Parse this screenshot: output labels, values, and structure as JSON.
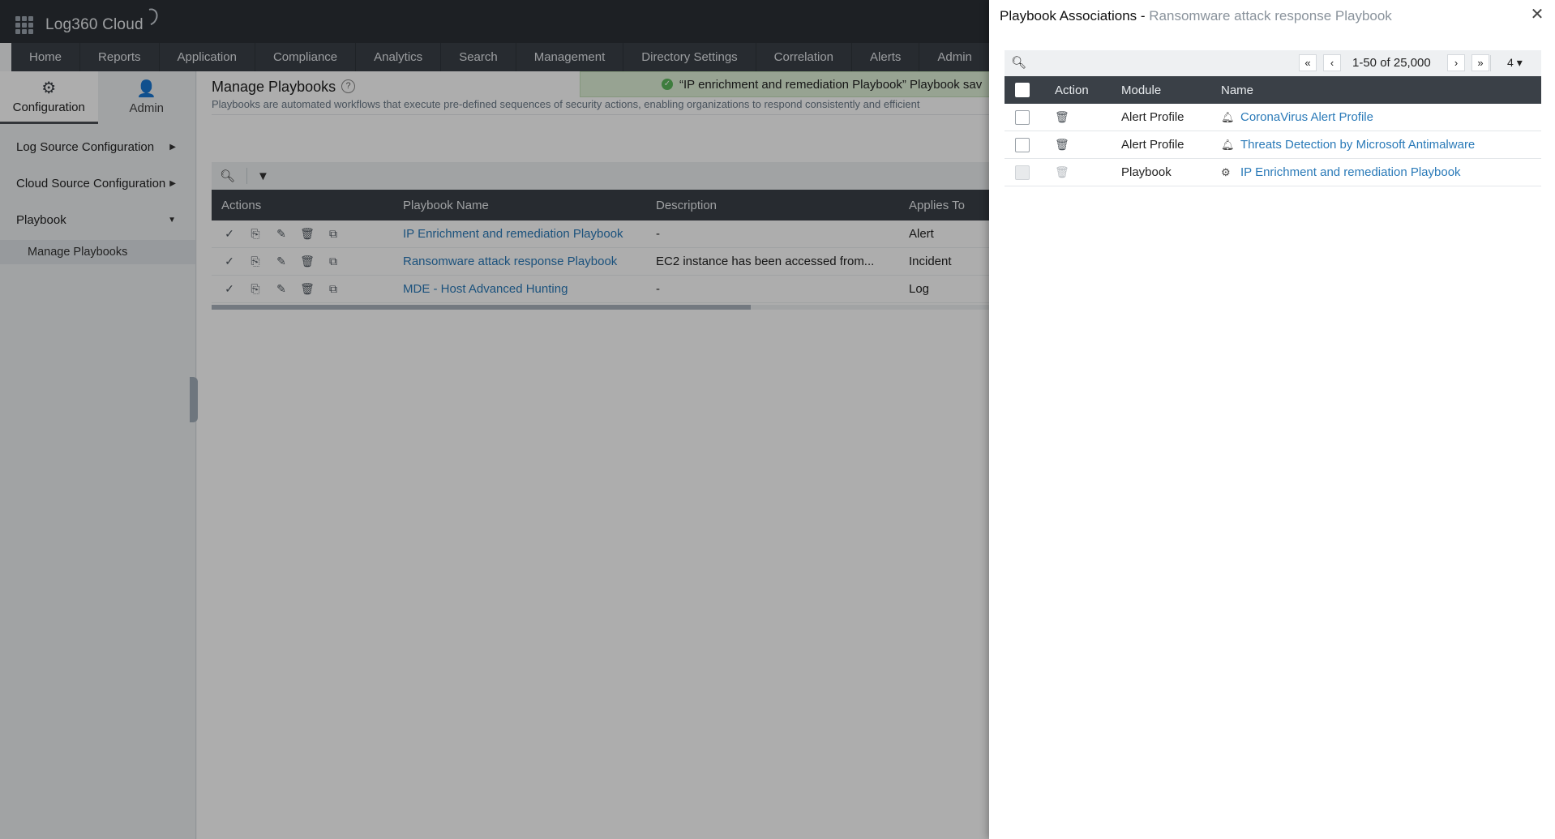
{
  "app": {
    "title": "Log360 Cloud"
  },
  "nav": [
    "Home",
    "Reports",
    "Application",
    "Compliance",
    "Analytics",
    "Search",
    "Management",
    "Directory Settings",
    "Correlation",
    "Alerts",
    "Admin"
  ],
  "sidebar": {
    "tabs": [
      {
        "label": "Configuration",
        "icon": "gear-icon"
      },
      {
        "label": "Admin",
        "icon": "user-icon"
      }
    ],
    "sections": [
      {
        "label": "Log Source Configuration",
        "caret": "right"
      },
      {
        "label": "Cloud Source Configuration",
        "caret": "right"
      },
      {
        "label": "Playbook",
        "caret": "down"
      }
    ],
    "sub_item": "Manage Playbooks"
  },
  "page": {
    "title": "Manage Playbooks",
    "description": "Playbooks are automated workflows that execute pre-defined sequences of security actions, enabling organizations to respond consistently and efficient",
    "toast": "“IP enrichment and remediation Playbook” Playbook sav"
  },
  "playbooks_table": {
    "headers": [
      "Actions",
      "Playbook Name",
      "Description",
      "Applies To"
    ],
    "rows": [
      {
        "name": "IP Enrichment and remediation Playbook",
        "description": "-",
        "applies_to": "Alert"
      },
      {
        "name": "Ransomware attack response Playbook",
        "description": "EC2 instance has been accessed from...",
        "applies_to": "Incident"
      },
      {
        "name": "MDE - Host Advanced Hunting",
        "description": "-",
        "applies_to": "Log"
      }
    ]
  },
  "panel": {
    "title": "Playbook Associations - ",
    "subtitle": "Ransomware attack response Playbook",
    "pagination": {
      "range": "1-50 of 25,000",
      "page_size": "4"
    },
    "headers": [
      "Action",
      "Module",
      "Name"
    ],
    "rows": [
      {
        "module": "Alert Profile",
        "name": "CoronaVirus Alert Profile",
        "icon": "bell-icon",
        "disabled": false
      },
      {
        "module": "Alert Profile",
        "name": "Threats Detection by Microsoft Antimalware",
        "icon": "bell-icon",
        "disabled": false
      },
      {
        "module": "Playbook",
        "name": "IP Enrichment and remediation Playbook",
        "icon": "playbook-icon",
        "disabled": true
      }
    ]
  }
}
